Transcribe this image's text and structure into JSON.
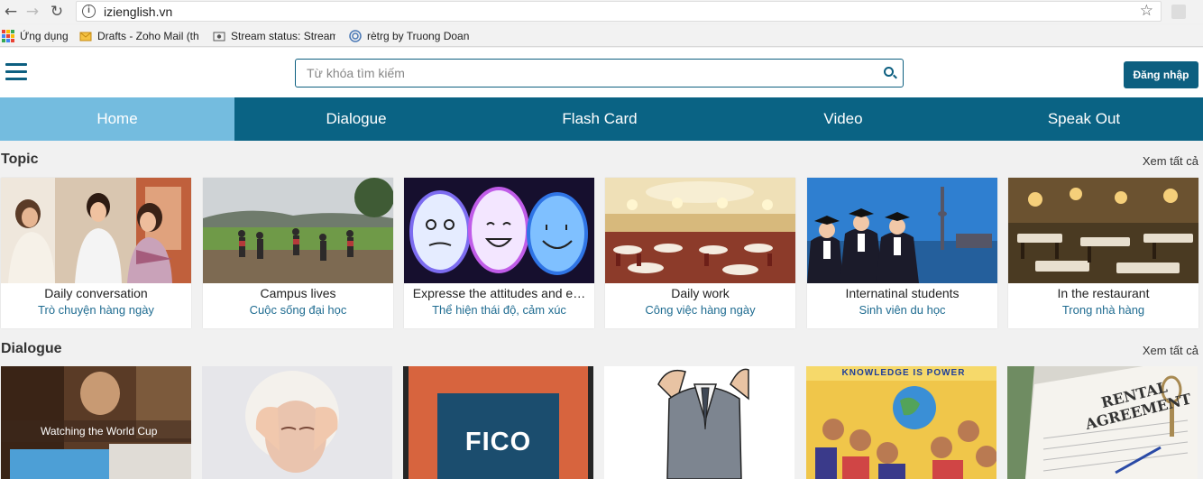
{
  "browser": {
    "url": "izienglish.vn",
    "bookmarks": [
      {
        "label": "Ứng dụng",
        "icon": "apps-grid-icon"
      },
      {
        "label": "Drafts - Zoho Mail (th",
        "icon": "mail-envelope-icon"
      },
      {
        "label": "Stream status: Stream",
        "icon": "stream-icon"
      },
      {
        "label": "rètrg by Truong Doan",
        "icon": "circle-logo-icon"
      }
    ]
  },
  "header": {
    "search_placeholder": "Từ khóa tìm kiếm",
    "login_label": "Đăng nhập"
  },
  "nav": {
    "tabs": [
      {
        "label": "Home",
        "active": true
      },
      {
        "label": "Dialogue",
        "active": false
      },
      {
        "label": "Flash Card",
        "active": false
      },
      {
        "label": "Video",
        "active": false
      },
      {
        "label": "Speak Out",
        "active": false
      }
    ]
  },
  "topic": {
    "title": "Topic",
    "see_all": "Xem tất cả",
    "cards": [
      {
        "en": "Daily conversation",
        "vi": "Trò chuyện hàng ngày"
      },
      {
        "en": "Campus lives",
        "vi": "Cuộc sống đại học"
      },
      {
        "en": "Expresse the attitudes and e…",
        "vi": "Thể hiện thái độ, cảm xúc"
      },
      {
        "en": "Daily work",
        "vi": "Công việc hàng ngày"
      },
      {
        "en": "Internatinal students",
        "vi": "Sinh viên du học"
      },
      {
        "en": "In the restaurant",
        "vi": "Trong nhà hàng"
      }
    ]
  },
  "dialogue": {
    "title": "Dialogue",
    "see_all": "Xem tất cả",
    "cards": [
      {
        "caption": "Watching the World Cup"
      },
      {
        "caption": ""
      },
      {
        "caption": "FICO"
      },
      {
        "caption": ""
      },
      {
        "caption": "KNOWLEDGE IS POWER"
      },
      {
        "caption": "RENTAL AGREEMENT"
      }
    ]
  },
  "colors": {
    "primary": "#0a6384",
    "active_tab": "#74bcdf",
    "link_text": "#1f6c91"
  }
}
